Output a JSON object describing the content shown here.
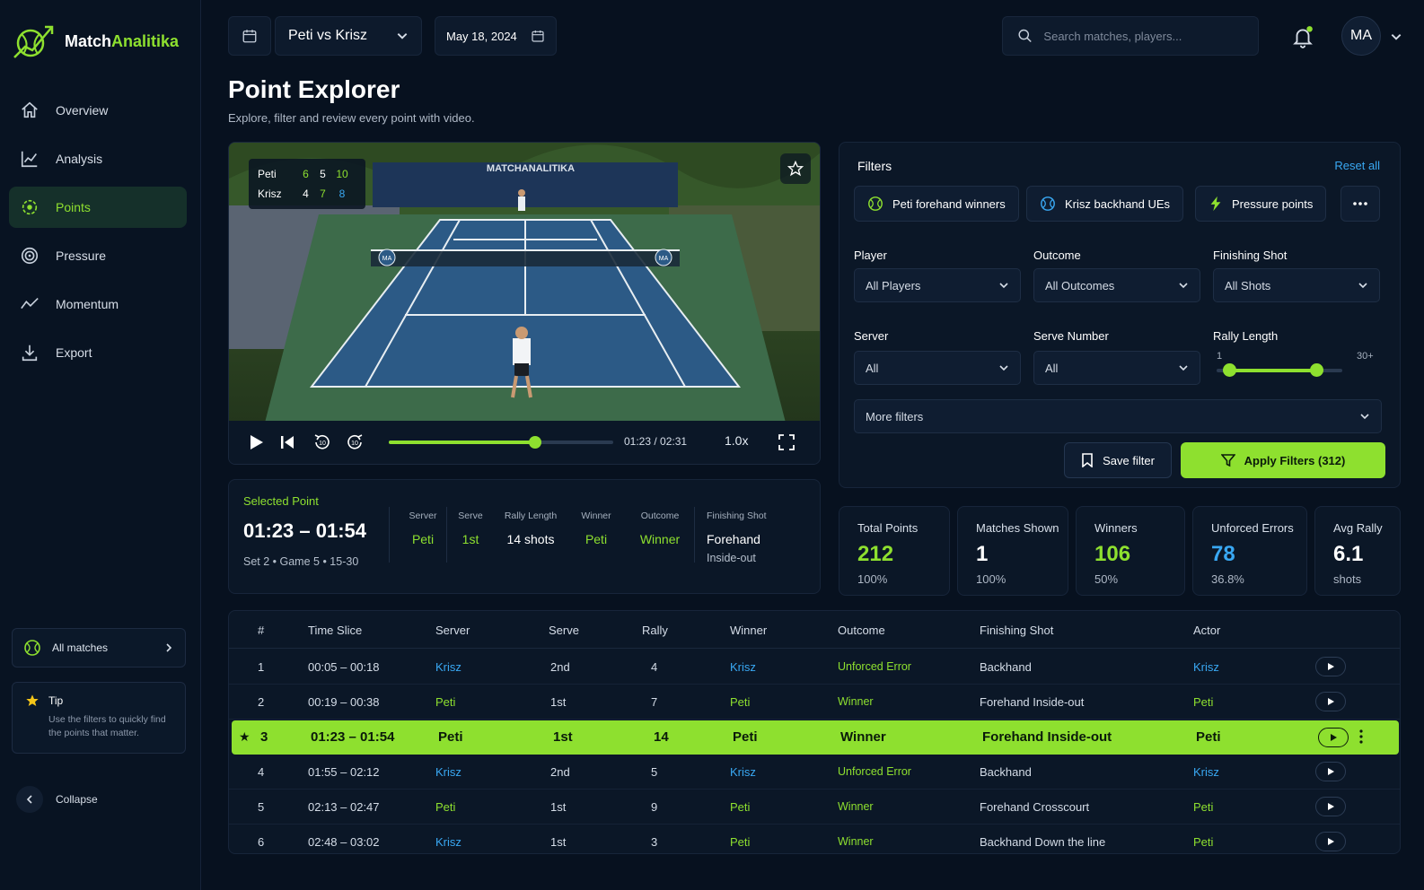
{
  "app": {
    "brand_prefix": "Match",
    "brand_suffix": "Analitika"
  },
  "sidebar": {
    "items": [
      {
        "label": "Overview",
        "icon": "home-icon"
      },
      {
        "label": "Analysis",
        "icon": "chart-icon"
      },
      {
        "label": "Points",
        "icon": "target-icon"
      },
      {
        "label": "Pressure",
        "icon": "pressure-icon"
      },
      {
        "label": "Momentum",
        "icon": "momentum-icon"
      },
      {
        "label": "Export",
        "icon": "download-icon"
      }
    ],
    "active_index": 2,
    "all_matches_label": "All matches",
    "tip_title": "Tip",
    "tip_text": "Use the filters to quickly find the points that matter.",
    "collapse_label": "Collapse"
  },
  "topbar": {
    "match_select": "Peti vs Krisz",
    "date": "May 18, 2024",
    "search_placeholder": "Search matches, players...",
    "avatar": "MA"
  },
  "page": {
    "title": "Point Explorer",
    "subtitle": "Explore, filter and review every point with video."
  },
  "video": {
    "score": [
      {
        "name": "Peti",
        "sets": [
          "6",
          "5"
        ],
        "points": "10"
      },
      {
        "name": "Krisz",
        "sets": [
          "4",
          "7"
        ],
        "points": "8"
      }
    ],
    "watermark": "MATCHANALITIKA",
    "court_logo": "MA",
    "time": "01:23 / 02:31",
    "speed": "1.0x",
    "progress": 0.65
  },
  "selected_point": {
    "label": "Selected Point",
    "time": "01:23 – 01:54",
    "meta": "Set 2  •  Game 5  •  15-30",
    "columns": [
      {
        "h": "Server",
        "v": "Peti"
      },
      {
        "h": "Serve",
        "v": "1st"
      },
      {
        "h": "Rally Length",
        "v": "14 shots"
      },
      {
        "h": "Winner",
        "v": "Peti"
      },
      {
        "h": "Outcome",
        "v": "Winner"
      },
      {
        "h": "Finishing Shot",
        "v": "Forehand",
        "v2": "Inside-out"
      }
    ]
  },
  "filters": {
    "title": "Filters",
    "reset": "Reset all",
    "chips": [
      "Peti forehand winners",
      "Krisz backhand UEs",
      "Pressure points"
    ],
    "player_label": "Player",
    "player_value": "All Players",
    "outcome_label": "Outcome",
    "outcome_value": "All Outcomes",
    "finishing_label": "Finishing Shot",
    "finishing_value": "All Shots",
    "server_label": "Server",
    "server_value": "All",
    "serve_number_label": "Serve Number",
    "serve_number_value": "All",
    "rally_label": "Rally Length",
    "rally_min": "1",
    "rally_max": "30+",
    "rally_range": [
      4,
      24
    ],
    "more_filters": "More filters",
    "save_label": "Save filter",
    "apply_label": "Apply Filters  (312)"
  },
  "stats": [
    {
      "h": "Total Points",
      "v": "212",
      "p": "100%",
      "color": "#8ee02f"
    },
    {
      "h": "Matches Shown",
      "v": "1",
      "p": "100%",
      "color": "#ffffff"
    },
    {
      "h": "Winners",
      "v": "106",
      "p": "50%",
      "color": "#8ee02f"
    },
    {
      "h": "Unforced Errors",
      "v": "78",
      "p": "36.8%",
      "color": "#39a8f3"
    },
    {
      "h": "Avg Rally",
      "v": "6.1",
      "p": "shots",
      "color": "#ffffff"
    }
  ],
  "table": {
    "headers": [
      "#",
      "Time Slice",
      "Server",
      "Serve",
      "Rally",
      "Winner",
      "Outcome",
      "Finishing Shot",
      "Actor"
    ],
    "rows": [
      [
        "1",
        "00:05 – 00:18",
        "Krisz",
        "2nd",
        "4",
        "Krisz",
        "Unforced Error",
        "Backhand",
        "Krisz"
      ],
      [
        "2",
        "00:19 – 00:38",
        "Peti",
        "1st",
        "7",
        "Peti",
        "Winner",
        "Forehand Inside-out",
        "Peti"
      ],
      [
        "3",
        "01:23 – 01:54",
        "Peti",
        "1st",
        "14",
        "Peti",
        "Winner",
        "Forehand Inside-out",
        "Peti"
      ],
      [
        "4",
        "01:55 – 02:12",
        "Krisz",
        "2nd",
        "5",
        "Krisz",
        "Unforced Error",
        "Backhand",
        "Krisz"
      ],
      [
        "5",
        "02:13 – 02:47",
        "Peti",
        "1st",
        "9",
        "Peti",
        "Winner",
        "Forehand Crosscourt",
        "Peti"
      ],
      [
        "6",
        "02:48 – 03:02",
        "Krisz",
        "1st",
        "3",
        "Peti",
        "Winner",
        "Backhand Down the line",
        "Peti"
      ]
    ],
    "selected_index": 2
  }
}
